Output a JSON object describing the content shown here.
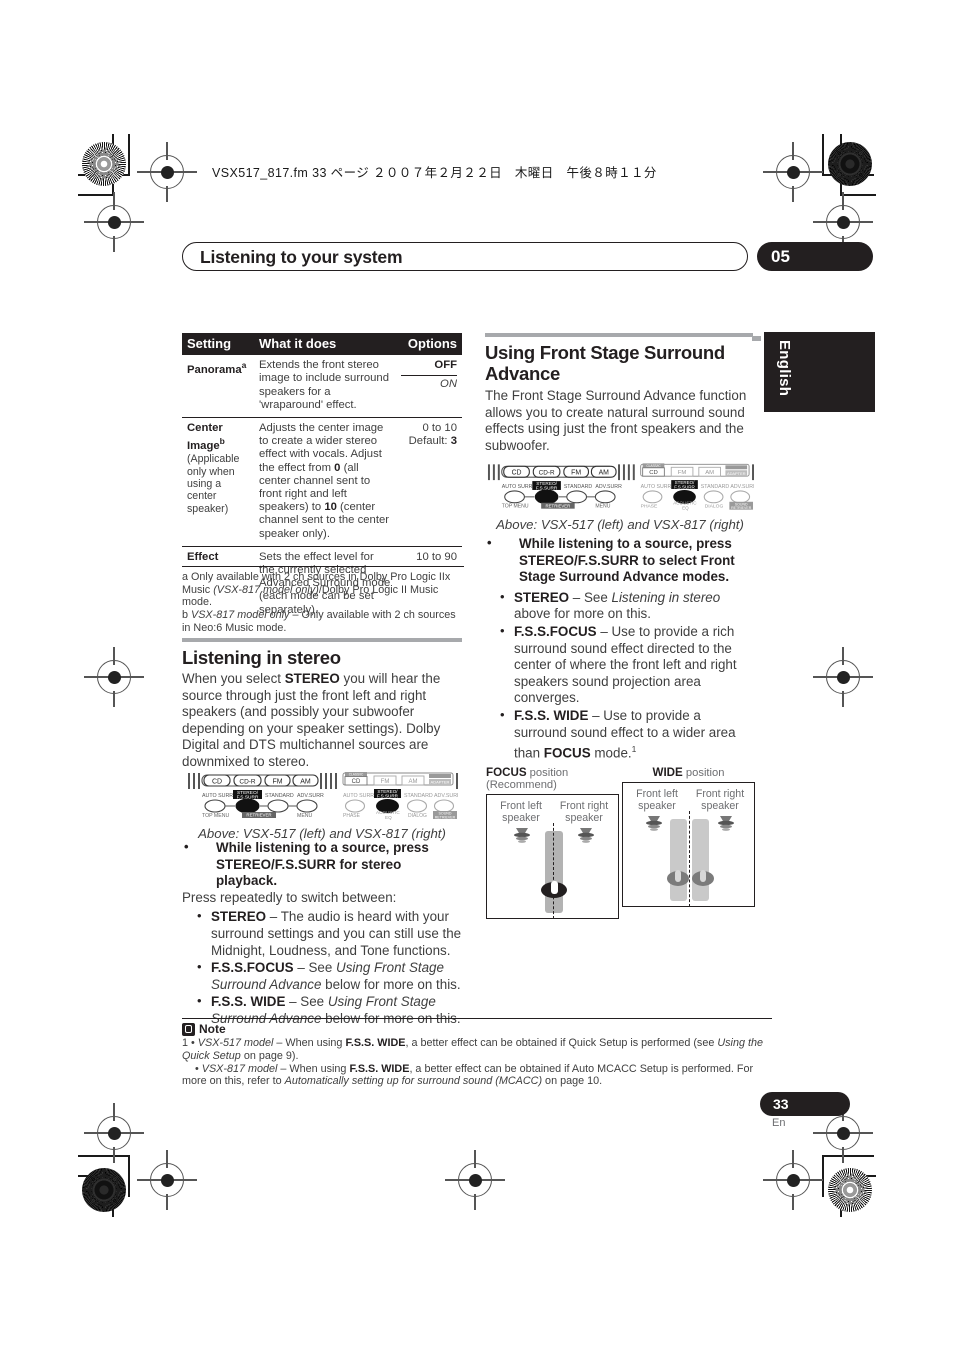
{
  "print_header": {
    "filename_line": "VSX517_817.fm  33 ページ  ２００７年２月２２日　木曜日　午後８時１１分"
  },
  "header": {
    "chapter_title": "Listening to your system",
    "chapter_number": "05"
  },
  "language_tab": {
    "label": "English"
  },
  "table": {
    "headers": {
      "setting": "Setting",
      "what": "What it does",
      "options": "Options"
    },
    "rows": [
      {
        "setting": "Panorama",
        "setting_sup": "a",
        "setting_note": "",
        "what": "Extends the front stereo image to include surround speakers for a 'wraparound' effect.",
        "option_primary": "OFF",
        "option_secondary": "ON"
      },
      {
        "setting": "Center Image",
        "setting_sup": "b",
        "setting_note": "(Applicable only when using a center speaker)",
        "what_pre": "Adjusts the center image to create a wider stereo effect with vocals. Adjust the effect from ",
        "what_b1": "0",
        "what_mid": " (all center channel sent to front right and left speakers) to ",
        "what_b2": "10",
        "what_post": " (center channel sent to the center speaker only).",
        "option_range": "0 to 10",
        "option_default_label": "Default: ",
        "option_default_value": "3"
      },
      {
        "setting": "Effect",
        "what": "Sets the effect level for the currently selected Advanced Surround mode (each mode can be set separately).",
        "option_range": "10 to 90"
      }
    ],
    "footnotes": {
      "a_marker": "a",
      "a_text_1": " Only available with 2 ch sources in Dolby Pro Logic IIx Music ",
      "a_italic": "(VSX-817 model only)",
      "a_text_2": "/Dolby Pro Logic II Music mode.",
      "b_marker": "b",
      "b_italic": "VSX-817 model only",
      "b_text": " – Only available with 2 ch sources in Neo:6 Music mode."
    }
  },
  "listening_in_stereo": {
    "heading": "Listening in stereo",
    "para_1_pre": "When you select ",
    "para_1_bold": "STEREO",
    "para_1_post": " you will hear the source through just the front left and right speakers (and possibly your subwoofer depending on your speaker settings). Dolby Digital and DTS multichannel sources are downmixed to stereo.",
    "figure_caption": "Above: VSX-517 (left) and VSX-817 (right)",
    "instruction_bold": "While listening to a source, press STEREO/F.S.SURR for stereo playback.",
    "instruction_follow": "Press repeatedly to switch between:",
    "bullets": [
      {
        "term": "STEREO",
        "dash": " – ",
        "desc": "The audio is heard with your surround settings and you can still use the Midnight, Loudness, and Tone functions."
      },
      {
        "term": "F.S.S.FOCUS",
        "dash": " – ",
        "desc_pre": "See ",
        "desc_italic": "Using Front Stage Surround Advance",
        "desc_post": " below for more on this."
      },
      {
        "term": "F.S.S. WIDE",
        "dash": " – ",
        "desc_pre": "See ",
        "desc_italic": "Using Front Stage Surround Advance",
        "desc_post": " below for more on this."
      }
    ]
  },
  "front_stage": {
    "heading": "Using Front Stage Surround Advance",
    "para_1": "The Front Stage Surround Advance function allows you to create natural surround sound effects using just the front speakers and the subwoofer.",
    "figure_caption": "Above: VSX-517 (left) and VSX-817 (right)",
    "instruction_bold": "While listening to a source, press STEREO/F.S.SURR to select Front Stage Surround Advance modes.",
    "bullets": [
      {
        "term": "STEREO",
        "dash": " – ",
        "desc_pre": "See ",
        "desc_italic": "Listening in stereo",
        "desc_post": " above for more on this."
      },
      {
        "term": "F.S.S.FOCUS",
        "dash": " – ",
        "desc": "Use to provide a rich surround sound effect directed to the center of where the front left and right speakers sound projection area converges."
      },
      {
        "term": "F.S.S. WIDE",
        "dash": " – ",
        "desc_pre": "Use to provide a surround sound effect to a wider area than ",
        "desc_bold": "FOCUS",
        "desc_post": " mode.",
        "sup": "1"
      }
    ]
  },
  "remote_figure": {
    "vsx517": {
      "source_buttons": [
        "CD",
        "CD-R",
        "FM",
        "AM"
      ],
      "mode_labels": [
        "AUTO SURR",
        "STEREO/\nF.S.SURR",
        "STANDARD",
        "ADV.SURR"
      ],
      "bottom_labels": [
        "TOP MENU",
        "RETRIEVER",
        "MENU"
      ]
    },
    "vsx817": {
      "source_buttons": [
        "CD",
        "FM",
        "AM",
        "ADAPTER"
      ],
      "top_mini_label": "CLASS/IC",
      "mode_labels": [
        "AUTO SURR",
        "STEREO/\nF.S.SURR",
        "STANDARD",
        "ADV.SURR"
      ],
      "bottom_labels": [
        "PHASE",
        "ACOUSTIC EQ",
        "DIALOG",
        "SOUND RETRIEVER"
      ]
    }
  },
  "speaker_figure": {
    "focus": {
      "title_bold": "FOCUS",
      "title_rest": " position (Recommend)",
      "left_label": "Front left\nspeaker",
      "right_label": "Front right\nspeaker"
    },
    "wide": {
      "title_bold": "WIDE",
      "title_rest": " position",
      "left_label": "Front left\nspeaker",
      "right_label": "Front right\nspeaker"
    }
  },
  "note": {
    "title": "Note",
    "item_1_marker": "1",
    "item_1_bullet": "•",
    "item_1_italic_1": "VSX-517 model",
    "item_1_text_1": " – When using ",
    "item_1_bold": "F.S.S. WIDE",
    "item_1_text_2": ", a better effect can be obtained if Quick Setup is performed (see ",
    "item_1_italic_2": "Using the Quick Setup",
    "item_1_text_3": " on page 9).",
    "item_2_bullet": "•",
    "item_2_italic_1": "VSX-817 model",
    "item_2_text_1": " – When using ",
    "item_2_bold": "F.S.S. WIDE",
    "item_2_text_2": ", a better effect can be obtained if Auto MCACC Setup is performed. For more on this, refer to ",
    "item_2_italic_2": "Automatically setting up for surround sound (MCACC)",
    "item_2_text_3": " on page 10."
  },
  "footer": {
    "page_number": "33",
    "language_code": "En"
  },
  "colors": {
    "ink": "#231f20",
    "body_gray": "#3f3f3f",
    "rule_gray": "#a7a9ac"
  }
}
